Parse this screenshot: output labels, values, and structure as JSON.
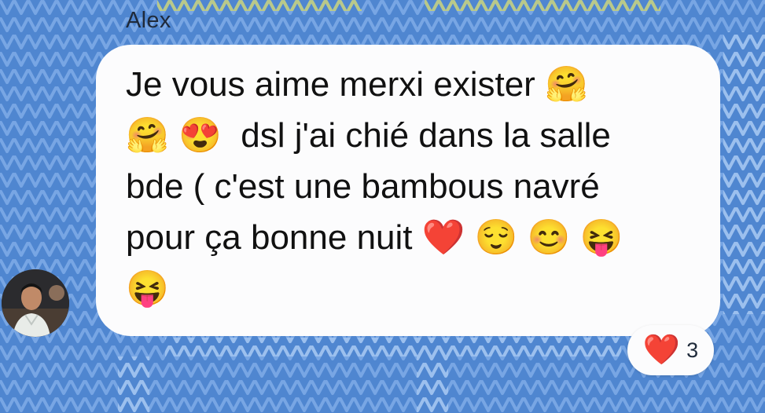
{
  "chat": {
    "sender_name": "Alex",
    "message_text": "Je vous aime merxi exister 🤗\n🤗 😍  dsl j'ai chié dans la salle\nbde ( c'est une bambous navré\npour ça bonne nuit ❤️ 😌 😊 😝\n😝",
    "avatar_icon": "user-avatar-photo",
    "reaction": {
      "emoji": "❤️",
      "count": "3",
      "color": "#e0262f"
    }
  },
  "theme": {
    "background": "#4f86d0",
    "pattern_blue": "#6f9fe0",
    "pattern_yellow": "#b9c98a",
    "bubble": "#fcfcfd"
  }
}
